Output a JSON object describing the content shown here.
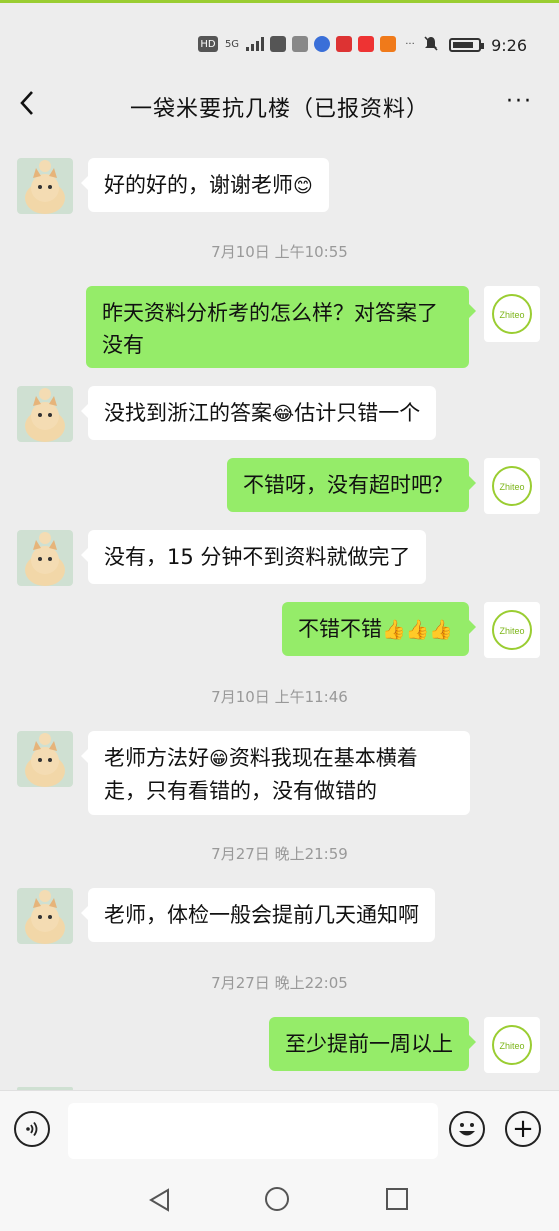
{
  "status_bar": {
    "time": "9:26",
    "indicators": [
      "HD",
      "5G",
      "46"
    ]
  },
  "header": {
    "title": "一袋米要抗几楼（已报资料）",
    "back_icon": "chevron-left-icon",
    "more_label": "···"
  },
  "messages": [
    {
      "side": "left",
      "text": "好的好的，谢谢老师",
      "emoji": "😊"
    },
    {
      "type": "time",
      "text": "7月10日 上午10:55"
    },
    {
      "side": "right",
      "text": "昨天资料分析考的怎么样？对答案了没有"
    },
    {
      "side": "left",
      "text_a": "没找到浙江的答案",
      "emoji": "😂",
      "text_b": "估计只错一个"
    },
    {
      "side": "right",
      "text": "不错呀，没有超时吧？"
    },
    {
      "side": "left",
      "text": "没有，15 分钟不到资料就做完了"
    },
    {
      "side": "right",
      "text": "不错不错",
      "emoji": "👍👍👍"
    },
    {
      "type": "time",
      "text": "7月10日 上午11:46"
    },
    {
      "side": "left",
      "text_a": "老师方法好",
      "emoji": "😁",
      "text_b": "资料我现在基本横着走，只有看错的，没有做错的"
    },
    {
      "type": "time",
      "text": "7月27日 晚上21:59"
    },
    {
      "side": "left",
      "text": "老师，体检一般会提前几天通知啊"
    },
    {
      "type": "time",
      "text": "7月27日 晚上22:05"
    },
    {
      "side": "right",
      "text": "至少提前一周以上"
    }
  ],
  "teacher_avatar_text": "Zhiteo",
  "colors": {
    "sent_bubble": "#95ec69",
    "received_bubble": "#ffffff",
    "background": "#ededed",
    "accent_line": "#9acd32"
  },
  "input_bar": {
    "voice_icon": "voice-icon",
    "emoji_icon": "emoji-icon",
    "plus_icon": "plus-icon",
    "plus_label": "+"
  }
}
